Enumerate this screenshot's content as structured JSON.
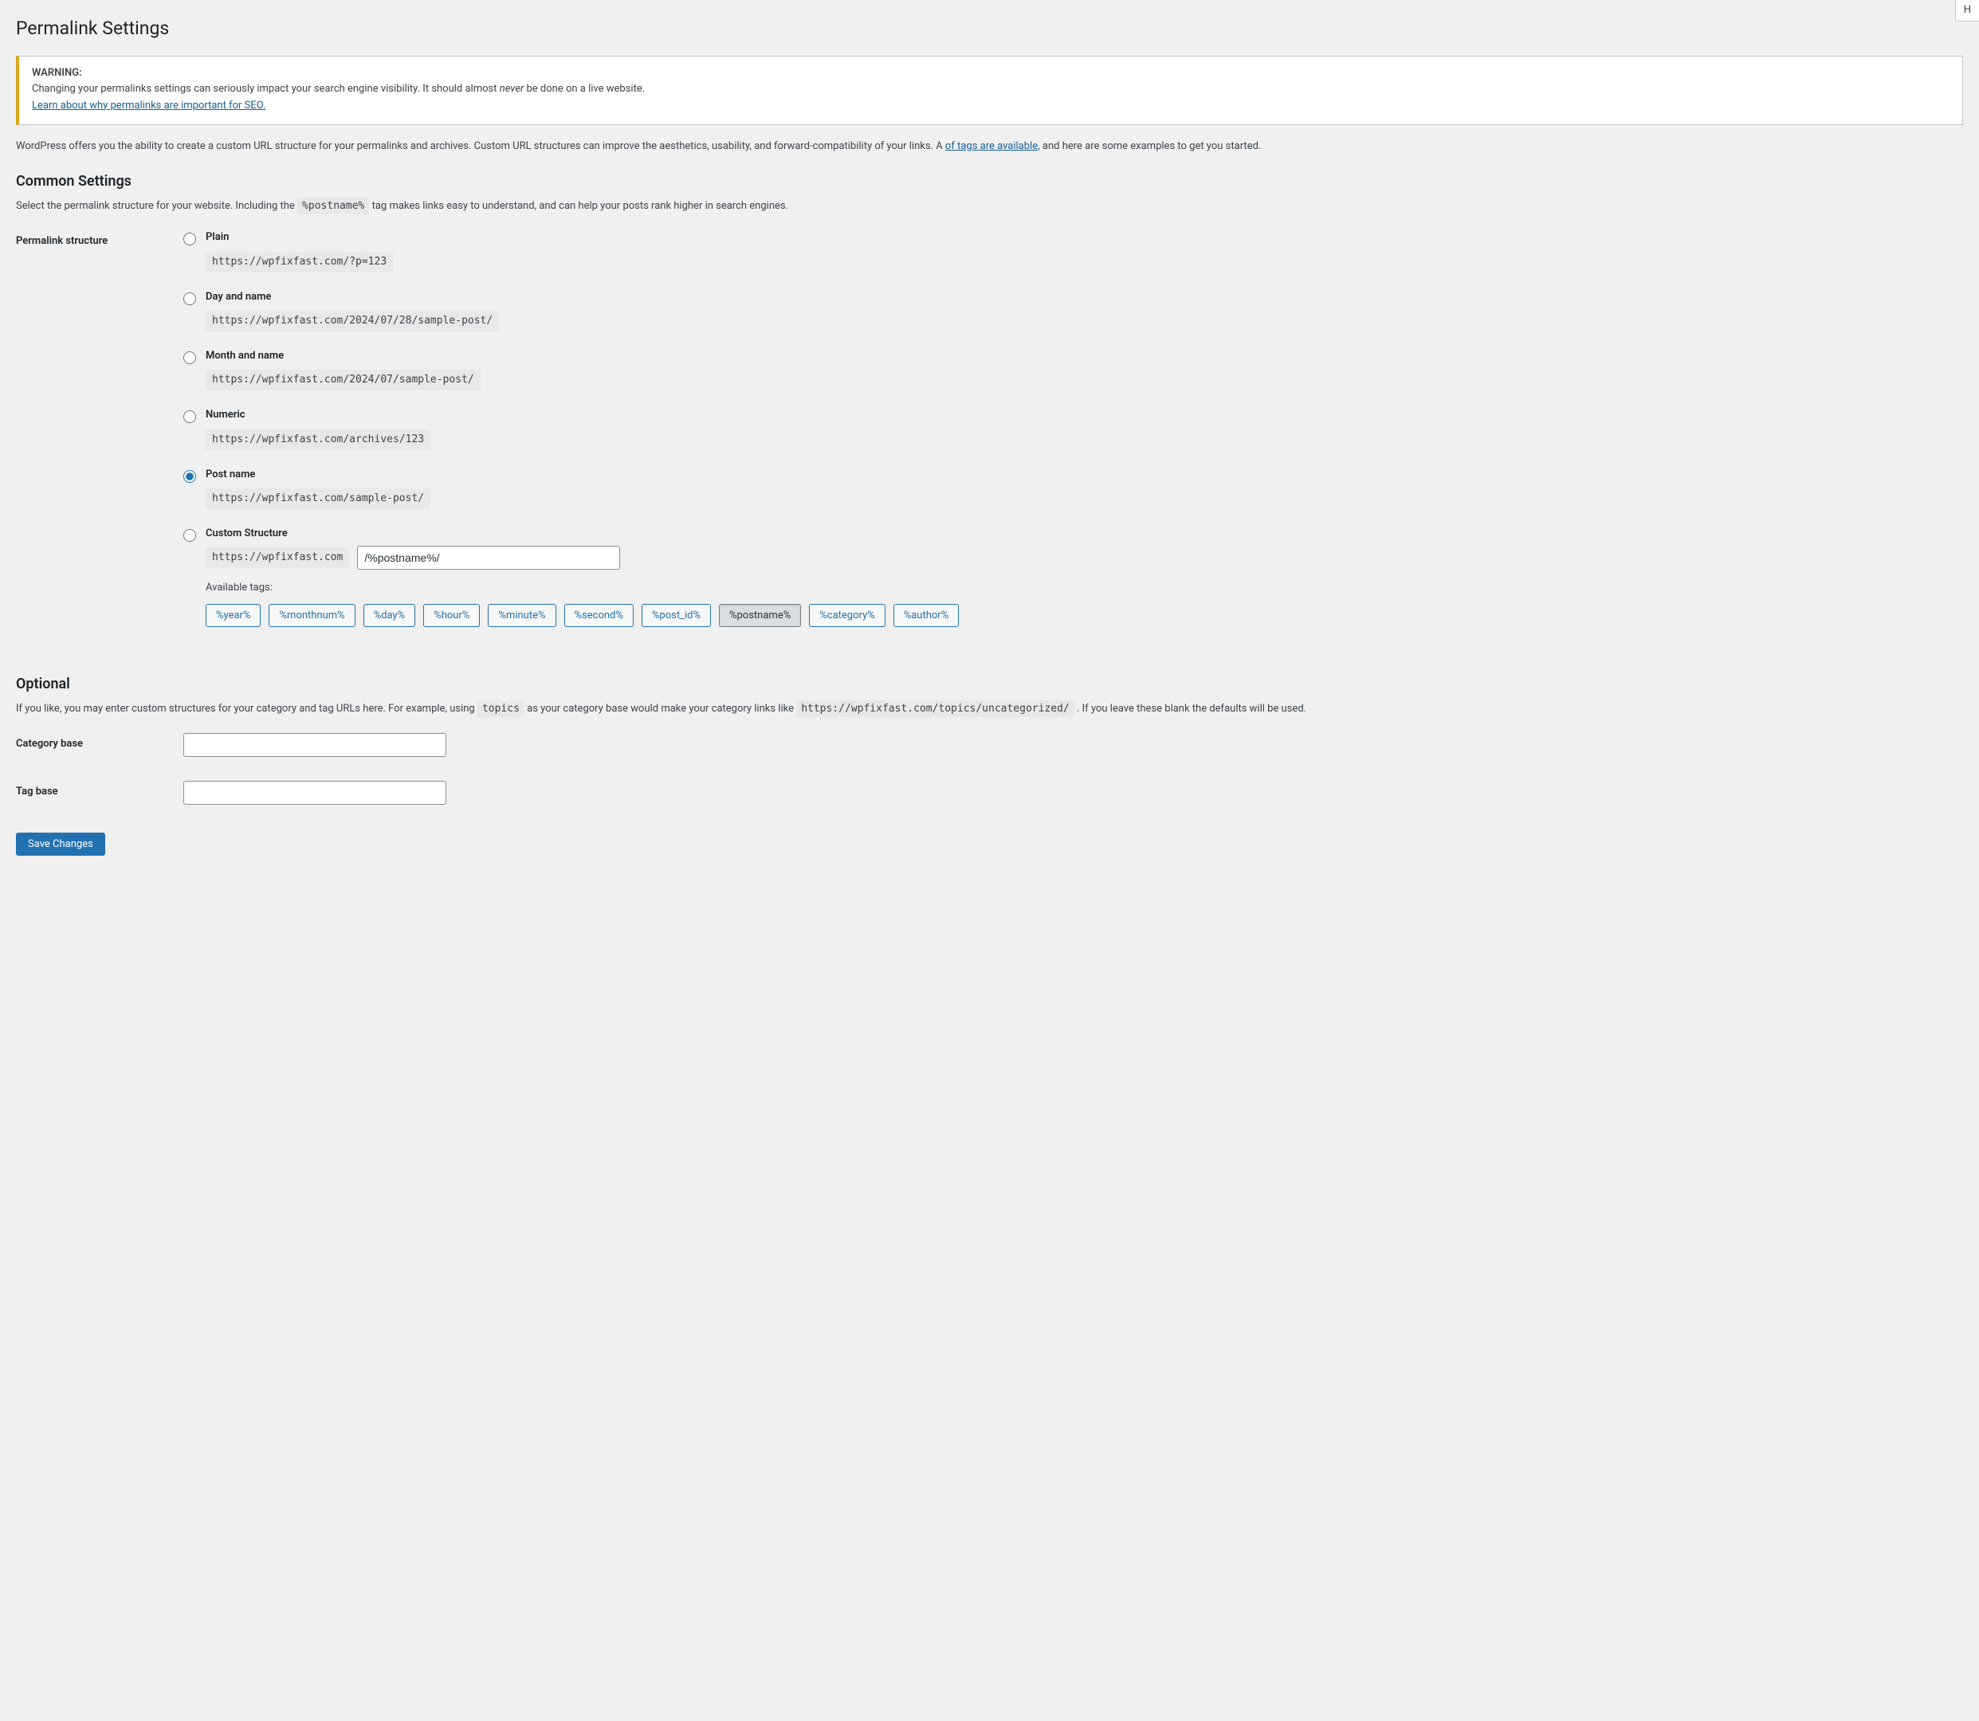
{
  "help_tab": "H",
  "page_title": "Permalink Settings",
  "warning": {
    "label": "WARNING:",
    "text_before_never": "Changing your permalinks settings can seriously impact your search engine visibility. It should almost ",
    "never": "never",
    "text_after_never": " be done on a live website.",
    "link": "Learn about why permalinks are important for SEO."
  },
  "intro": {
    "text_before_link": "WordPress offers you the ability to create a custom URL structure for your permalinks and archives. Custom URL structures can improve the aesthetics, usability, and forward-compatibility of your links. A ",
    "link": "of tags are available",
    "text_after_link": ", and here are some examples to get you started."
  },
  "common": {
    "heading": "Common Settings",
    "desc_before_code": "Select the permalink structure for your website. Including the ",
    "desc_code": "%postname%",
    "desc_after_code": " tag makes links easy to understand, and can help your posts rank higher in search engines.",
    "th_label": "Permalink structure"
  },
  "options": {
    "plain": {
      "label": "Plain",
      "example": "https://wpfixfast.com/?p=123"
    },
    "dayname": {
      "label": "Day and name",
      "example": "https://wpfixfast.com/2024/07/28/sample-post/"
    },
    "monthname": {
      "label": "Month and name",
      "example": "https://wpfixfast.com/2024/07/sample-post/"
    },
    "numeric": {
      "label": "Numeric",
      "example": "https://wpfixfast.com/archives/123"
    },
    "postname": {
      "label": "Post name",
      "example": "https://wpfixfast.com/sample-post/"
    },
    "custom": {
      "label": "Custom Structure",
      "base": "https://wpfixfast.com",
      "value": "/%postname%/"
    }
  },
  "available_tags": {
    "label": "Available tags:",
    "tags": [
      "%year%",
      "%monthnum%",
      "%day%",
      "%hour%",
      "%minute%",
      "%second%",
      "%post_id%",
      "%postname%",
      "%category%",
      "%author%"
    ],
    "active_index": 7
  },
  "optional": {
    "heading": "Optional",
    "desc_p1": "If you like, you may enter custom structures for your category and tag URLs here. For example, using ",
    "desc_code1": "topics",
    "desc_p2": " as your category base would make your category links like ",
    "desc_code2": "https://wpfixfast.com/topics/uncategorized/",
    "desc_p3": " . If you leave these blank the defaults will be used.",
    "category_label": "Category base",
    "tag_label": "Tag base",
    "category_value": "",
    "tag_value": ""
  },
  "submit": "Save Changes"
}
